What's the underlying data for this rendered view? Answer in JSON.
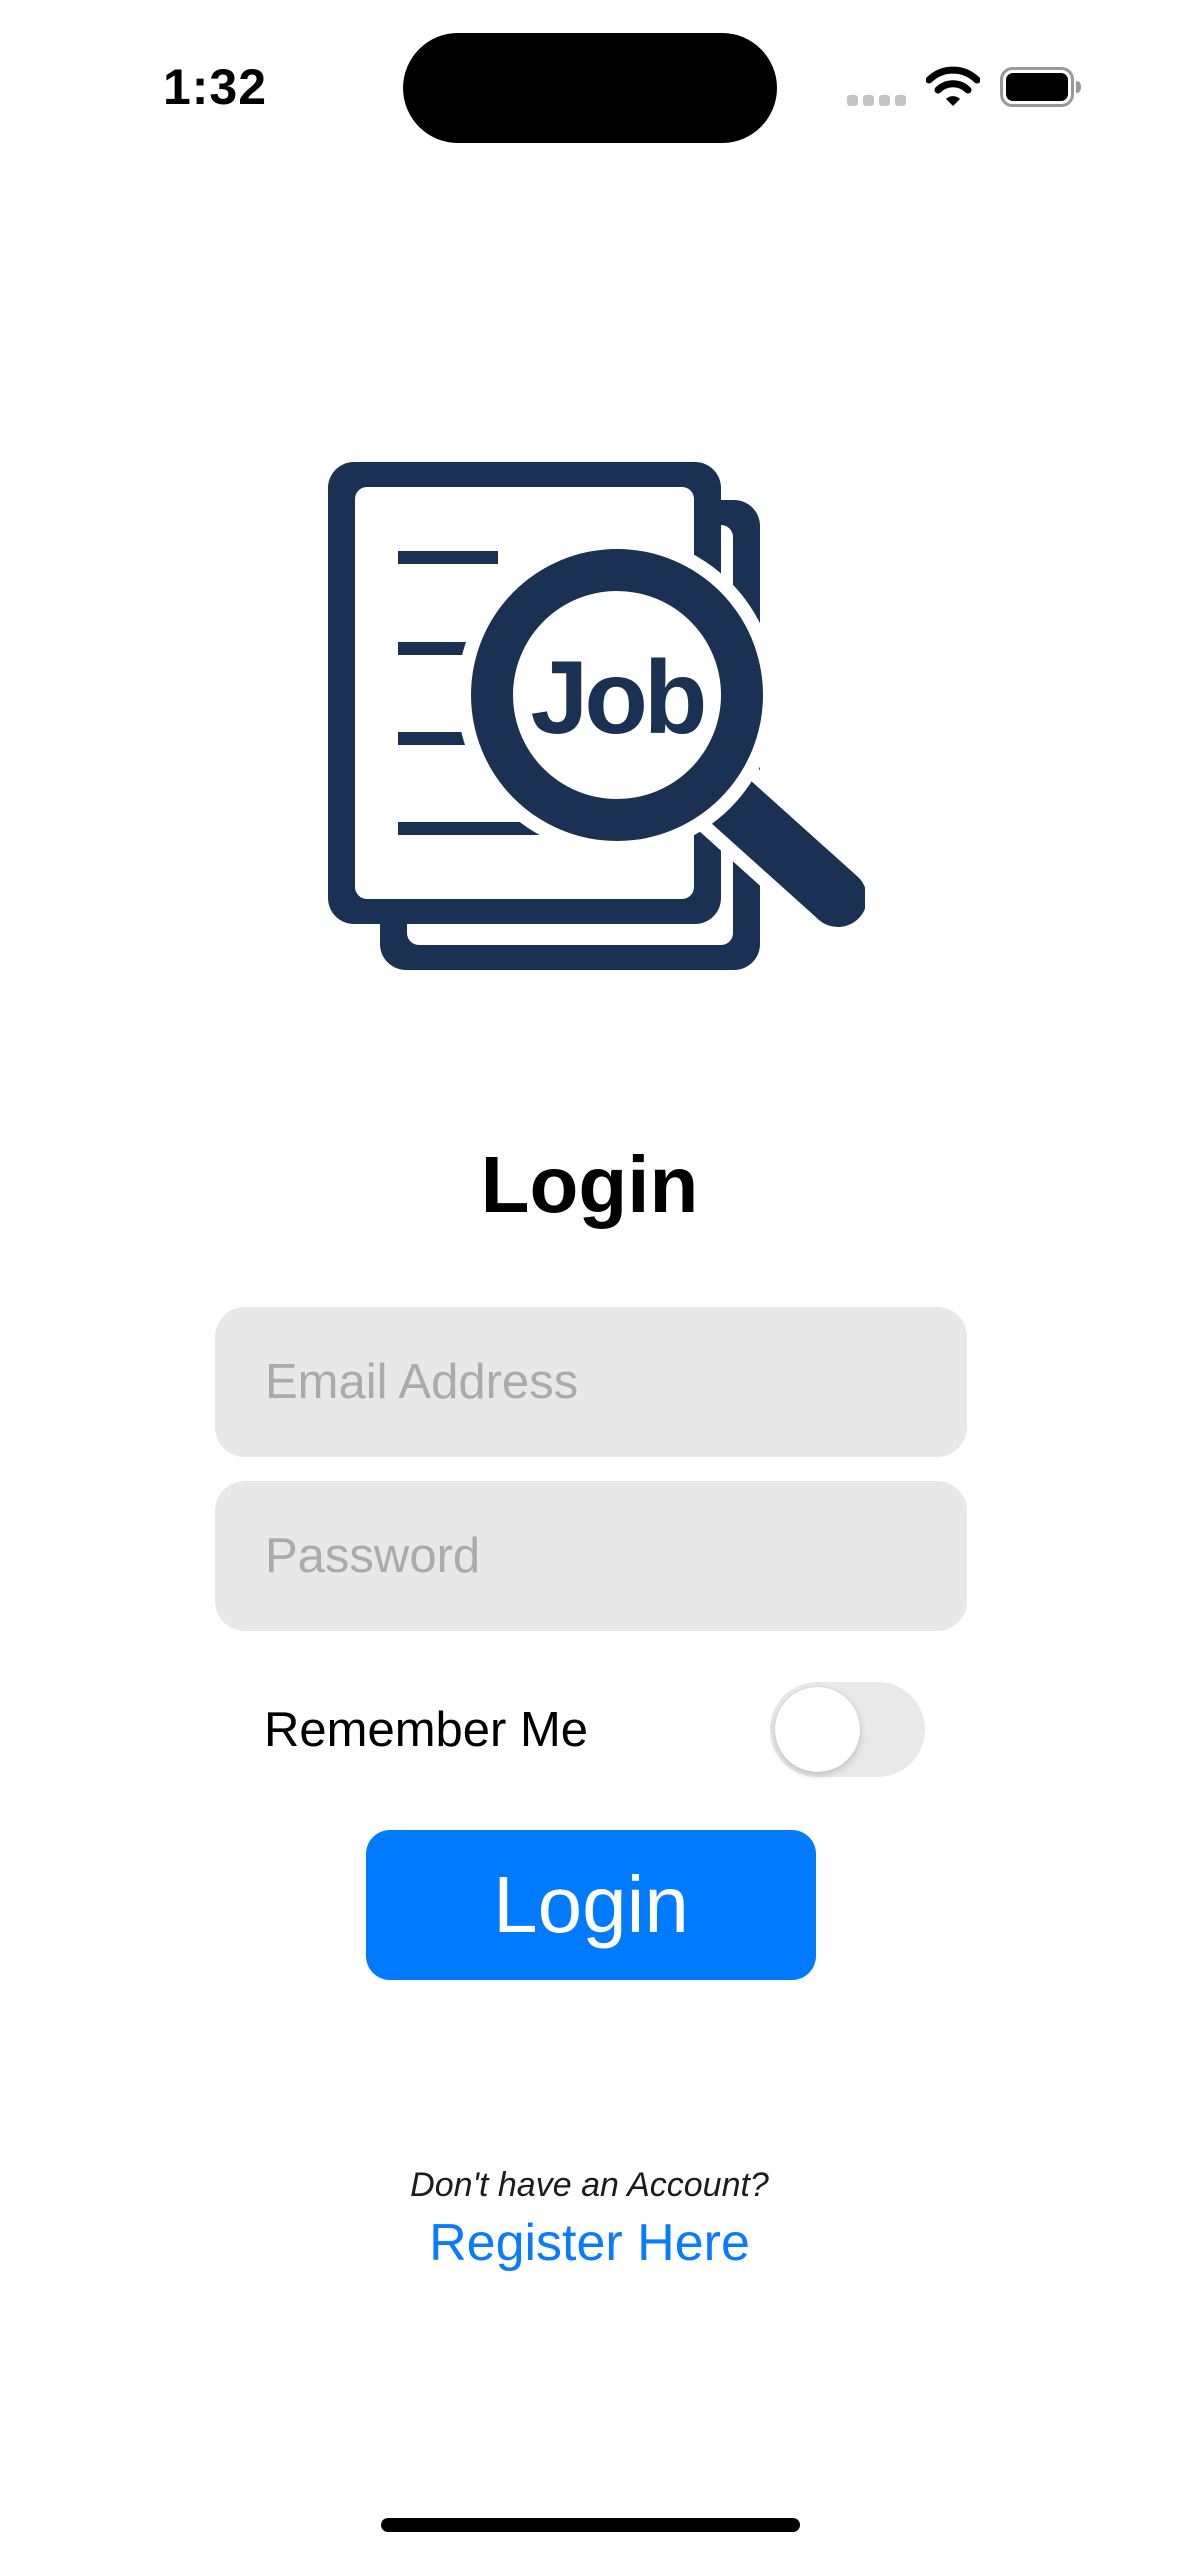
{
  "status_bar": {
    "time": "1:32"
  },
  "logo": {
    "icon": "job-search-icon",
    "text": "Job",
    "color": "#1b3153"
  },
  "login": {
    "title": "Login",
    "email_placeholder": "Email Address",
    "email_value": "",
    "password_placeholder": "Password",
    "password_value": "",
    "remember_me_label": "Remember Me",
    "remember_me_on": false,
    "button_label": "Login",
    "button_color": "#007aff"
  },
  "register": {
    "prompt": "Don't have an Account?",
    "link_label": "Register Here",
    "link_color": "#0a7aff"
  }
}
